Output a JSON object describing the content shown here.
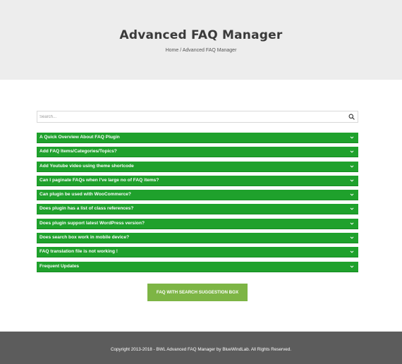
{
  "hero": {
    "title": "Advanced FAQ Manager",
    "breadcrumb_home": "Home",
    "breadcrumb_separator": "/",
    "breadcrumb_current": "Advanced FAQ Manager"
  },
  "search": {
    "placeholder": "Search...",
    "value": "",
    "icon": "search-icon"
  },
  "faq": {
    "accent_color": "#1fa12c",
    "chevron_icon": "chevron-down-icon",
    "items": [
      {
        "label": "A Quick Overview About FAQ Plugin"
      },
      {
        "label": "Add FAQ Items/Categories/Topics?"
      },
      {
        "label": "Add Youtube video using theme shortcode"
      },
      {
        "label": "Can I paginate FAQs when I've large no of FAQ items?"
      },
      {
        "label": "Can plugin be used with WooCommerce?"
      },
      {
        "label": "Does plugin has a list of class references?"
      },
      {
        "label": "Does plugin support latest WordPress version?"
      },
      {
        "label": "Does search box work in mobile device?"
      },
      {
        "label": "FAQ translation file is not working !"
      },
      {
        "label": "Frequent Updates"
      }
    ]
  },
  "cta": {
    "label": "FAQ WITH SEARCH SUGGESTION BOX",
    "color": "#7db545"
  },
  "footer": {
    "text": "Copyright 2013-2018 - BWL Advanced FAQ Manager by BlueWindLab. All Rights Reserved."
  }
}
